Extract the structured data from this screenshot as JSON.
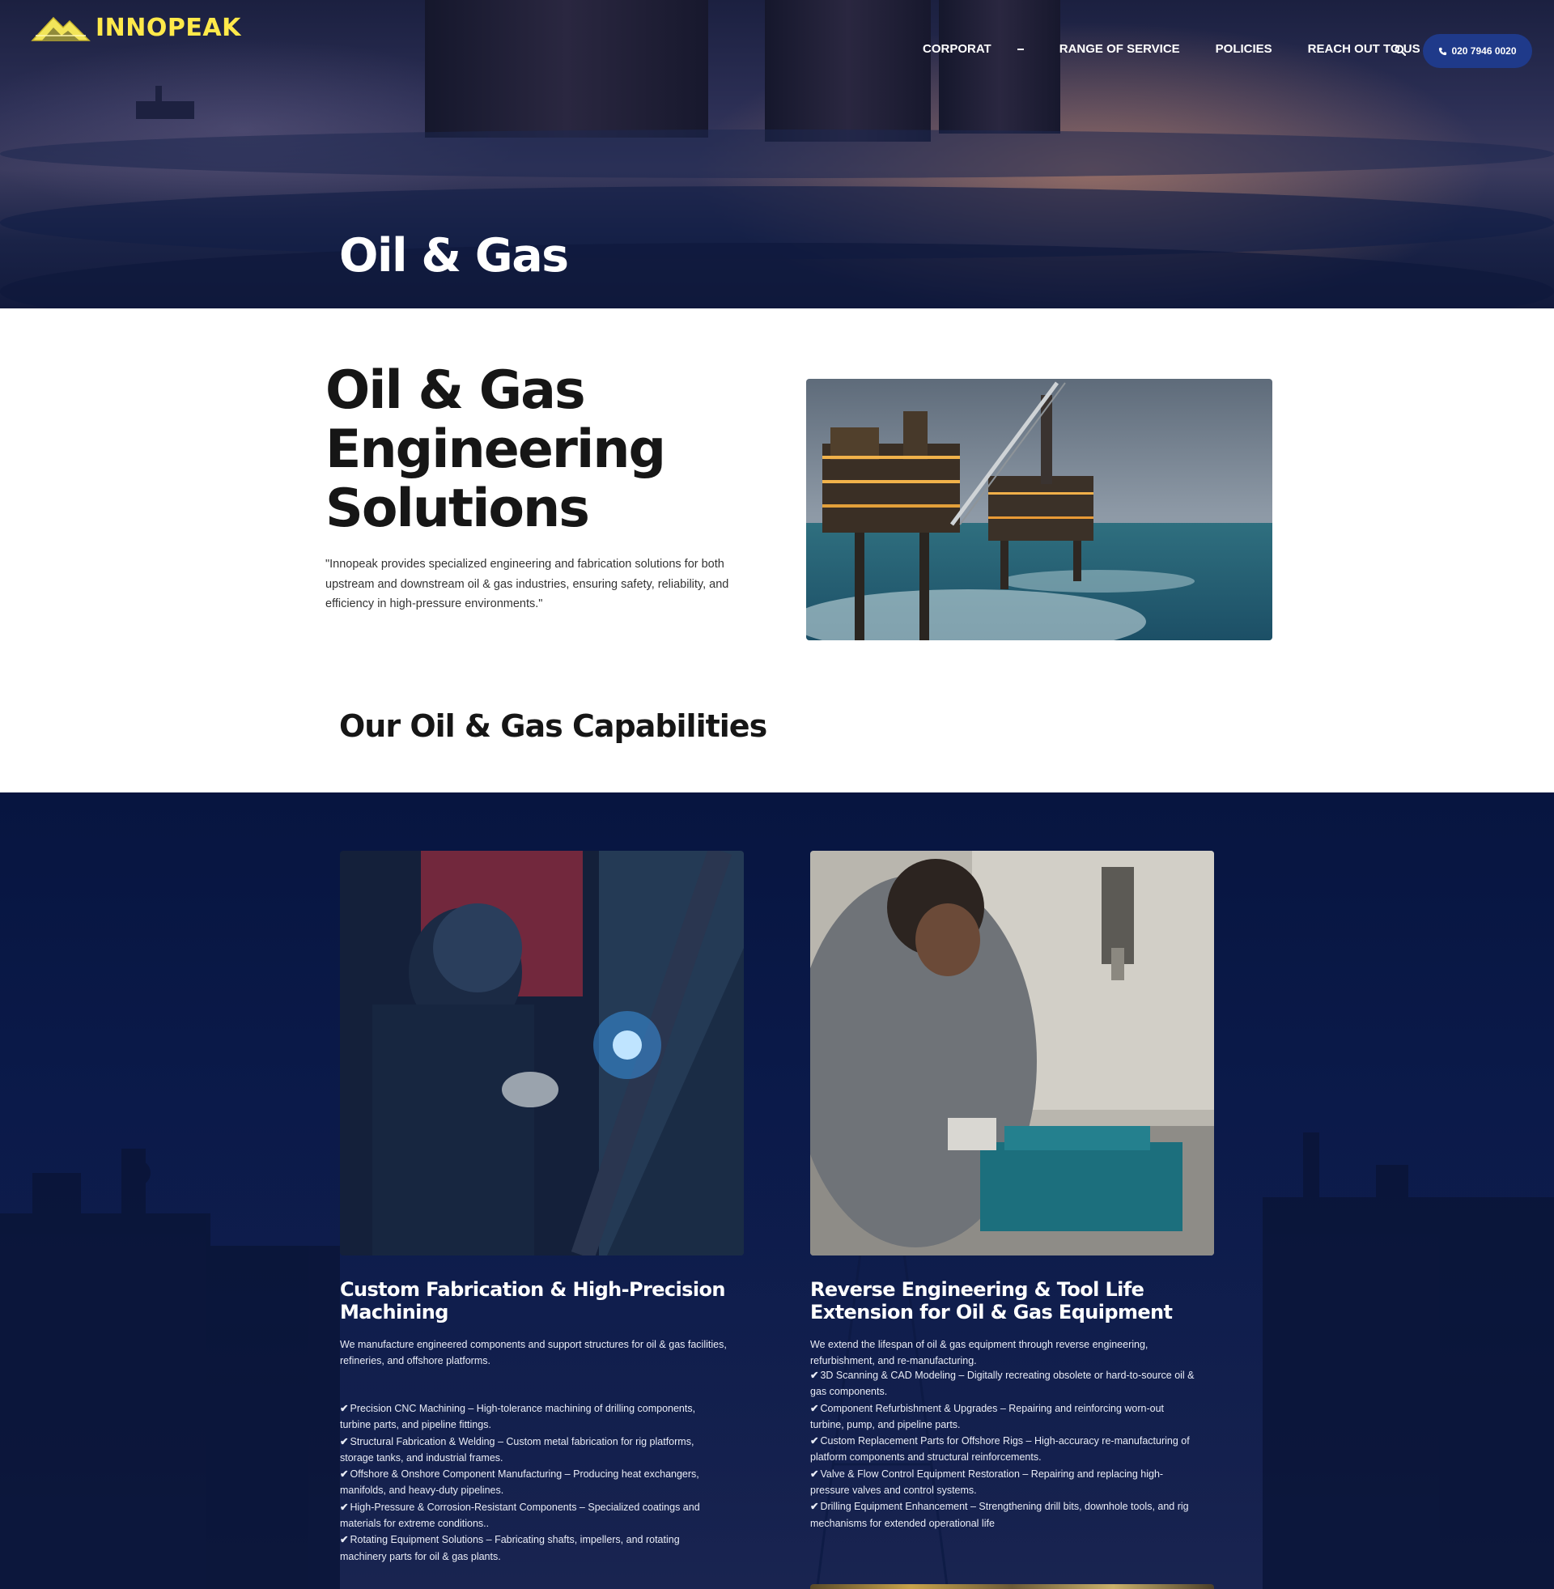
{
  "brand": {
    "name": "INNOPEAK",
    "logo_color": "#ffe94a"
  },
  "nav": {
    "items": [
      {
        "label": "CORPORAT"
      },
      {
        "label": "RANGE OF SERVICE"
      },
      {
        "label": "POLICIES"
      },
      {
        "label": "REACH OUT TO US"
      }
    ],
    "search_icon": "search-icon",
    "phone": {
      "icon": "phone-icon",
      "label": "020 7946 0020"
    }
  },
  "hero": {
    "title": "Oil & Gas"
  },
  "intro": {
    "title_lines": [
      "Oil & Gas",
      "Engineering",
      "Solutions"
    ],
    "text": "\"Innopeak provides specialized engineering and fabrication solutions for both upstream and downstream oil & gas industries, ensuring safety, reliability, and efficiency in high-pressure environments.\""
  },
  "capabilities": {
    "heading": "Our Oil & Gas Capabilities",
    "cards": [
      {
        "title": "Custom Fabrication & High-Precision Machining",
        "desc": "We manufacture engineered components and support structures for oil & gas facilities, refineries, and offshore platforms.",
        "items": [
          "Precision CNC Machining – High-tolerance machining of drilling components, turbine parts, and pipeline fittings.",
          "Structural Fabrication & Welding – Custom metal fabrication for rig platforms, storage tanks, and industrial frames.",
          "Offshore & Onshore Component Manufacturing – Producing heat exchangers, manifolds, and heavy-duty pipelines.",
          "High-Pressure & Corrosion-Resistant Components – Specialized coatings and materials for extreme conditions..",
          "Rotating Equipment Solutions – Fabricating shafts, impellers, and rotating machinery parts for oil & gas plants."
        ]
      },
      {
        "title": "Reverse Engineering & Tool Life Extension for Oil & Gas Equipment",
        "desc": "We extend the lifespan of oil & gas equipment through reverse engineering, refurbishment, and re-manufacturing.",
        "items": [
          "3D Scanning & CAD Modeling – Digitally recreating obsolete or hard-to-source oil & gas components.",
          "Component Refurbishment & Upgrades – Repairing and reinforcing worn-out turbine, pump, and pipeline parts.",
          "Custom Replacement Parts for Offshore Rigs – High-accuracy re-manufacturing of platform components and structural reinforcements.",
          "Valve & Flow Control Equipment Restoration – Repairing and replacing high-pressure valves and control systems.",
          "Drilling Equipment Enhancement – Strengthening drill bits, downhole tools, and rig mechanisms for extended operational life"
        ]
      }
    ]
  },
  "colors": {
    "dark_section": "#0b1a4a",
    "phone_button": "#1f3a8a",
    "accent_yellow": "#ffe94a"
  }
}
